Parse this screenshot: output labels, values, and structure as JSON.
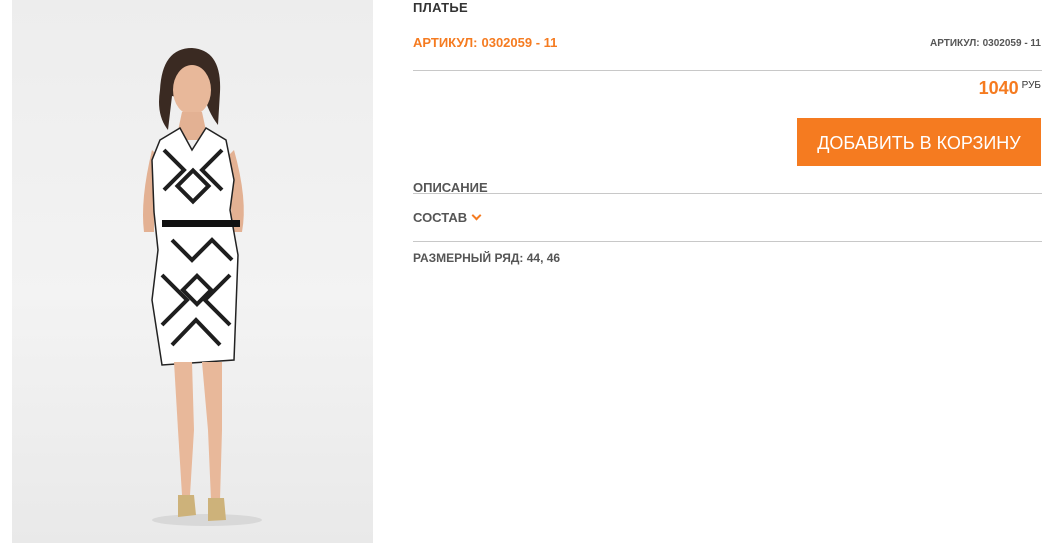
{
  "product": {
    "title": "ПЛАТЬЕ",
    "article_label": "АРТИКУЛ:",
    "article_value": "0302059 - 11",
    "article_small_label": "АРТИКУЛ:",
    "article_small_value": "0302059 - 11",
    "price": "1040",
    "currency": "РУБ",
    "add_to_cart": "ДОБАВИТЬ В КОРЗИНУ",
    "description_label": "ОПИСАНИЕ",
    "composition_label": "СОСТАВ",
    "sizes_text": "РАЗМЕРНЫЙ РЯД: 44, 46",
    "photo_icon": "model-photo"
  },
  "colors": {
    "accent": "#f57b20",
    "text": "#555555",
    "divider": "#c8c8c8"
  }
}
